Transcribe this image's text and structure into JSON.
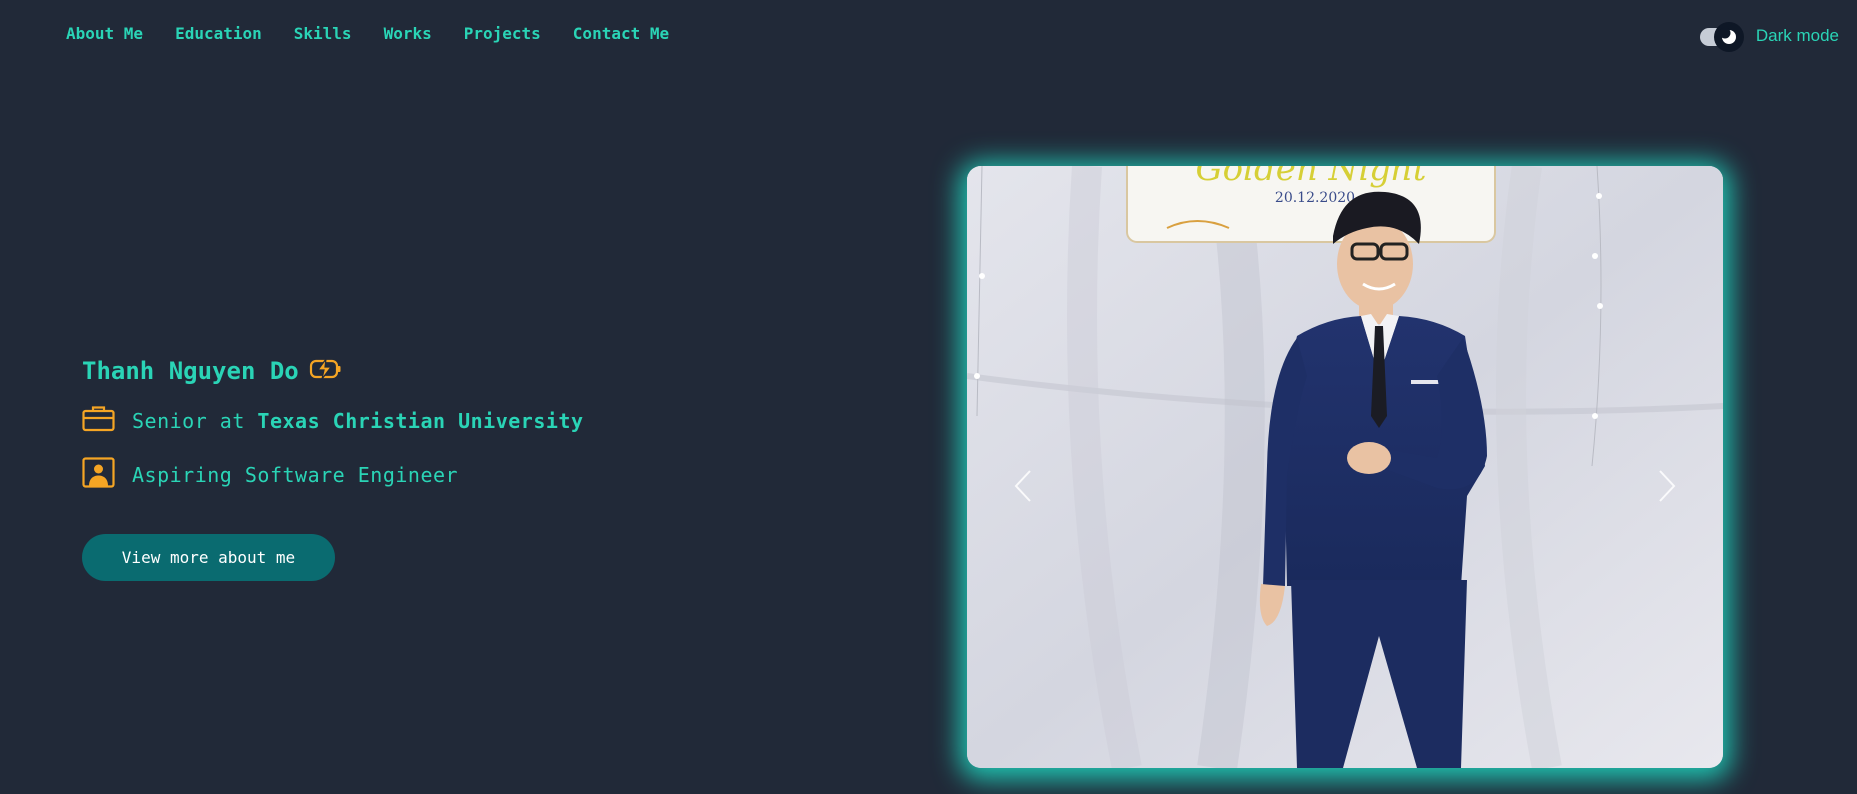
{
  "nav": {
    "items": [
      "About Me",
      "Education",
      "Skills",
      "Works",
      "Projects",
      "Contact Me"
    ]
  },
  "theme": {
    "toggle_label": "Dark mode",
    "dark_mode_on": true
  },
  "hero": {
    "name": "Thanh Nguyen Do",
    "role_prefix": "Senior at",
    "school": "Texas Christian University",
    "tagline": "Aspiring Software Engineer",
    "cta_label": "View more about me"
  },
  "carousel": {
    "sign_text": "Golden Night",
    "sign_date": "20.12.2020"
  },
  "icons": {
    "name_badge": "bolt-icon",
    "role": "briefcase-icon",
    "tagline": "user-badge-icon",
    "toggle_knob": "moon-icon",
    "prev": "chevron-left-icon",
    "next": "chevron-right-icon"
  },
  "colors": {
    "background": "#212938",
    "accent": "#2ad4b6",
    "icon_orange": "#f5a524",
    "button": "#0a6b70",
    "glow": "#20dcc4"
  }
}
